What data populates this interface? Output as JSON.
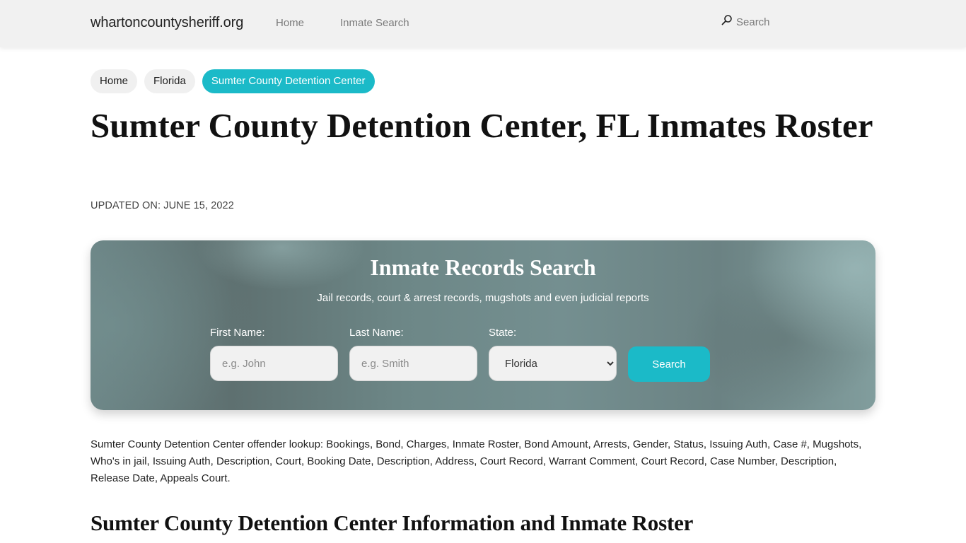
{
  "navbar": {
    "brand": "whartoncountysheriff.org",
    "links": [
      {
        "label": "Home"
      },
      {
        "label": "Inmate Search"
      }
    ],
    "search": {
      "label": "Search",
      "icon": "search-icon"
    }
  },
  "breadcrumb": [
    {
      "label": "Home",
      "active": false
    },
    {
      "label": "Florida",
      "active": false
    },
    {
      "label": "Sumter County Detention Center",
      "active": true
    }
  ],
  "page": {
    "title": "Sumter County Detention Center, FL Inmates Roster",
    "updated": "UPDATED ON: JUNE 15, 2022"
  },
  "search_panel": {
    "title": "Inmate Records Search",
    "subtitle": "Jail records, court & arrest records, mugshots and even judicial reports",
    "first_name": {
      "label": "First Name:",
      "placeholder": "e.g. John",
      "value": ""
    },
    "last_name": {
      "label": "Last Name:",
      "placeholder": "e.g. Smith",
      "value": ""
    },
    "state": {
      "label": "State:",
      "selected": "Florida"
    },
    "button_label": "Search"
  },
  "description": "Sumter County Detention Center offender lookup: Bookings, Bond, Charges, Inmate Roster, Bond Amount, Arrests, Gender, Status, Issuing Auth, Case #, Mugshots, Who's in jail, Issuing Auth, Description, Court, Booking Date, Description, Address, Court Record, Warrant Comment, Court Record, Case Number, Description, Release Date, Appeals Court.",
  "section_title": "Sumter County Detention Center Information and Inmate Roster",
  "colors": {
    "accent": "#1bbac8",
    "navbar_bg": "#f1f1f1"
  }
}
